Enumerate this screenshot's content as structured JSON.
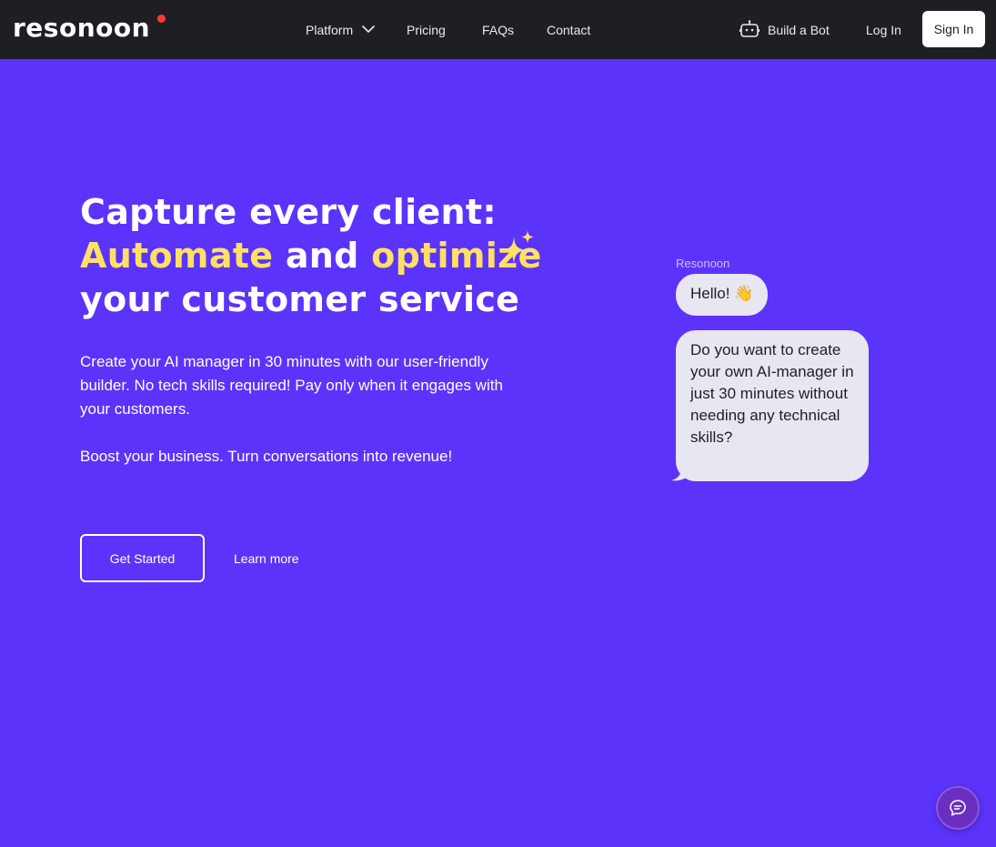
{
  "header": {
    "logo": "resonoon",
    "nav": [
      {
        "label": "Platform"
      },
      {
        "label": "Pricing"
      },
      {
        "label": "FAQs"
      },
      {
        "label": "Contact"
      }
    ],
    "build_bot": "Build a Bot",
    "login": "Log In",
    "signin": "Sign In"
  },
  "hero": {
    "line1": "Capture every client:",
    "accent1": "Automate",
    "and": " and ",
    "accent2": "optimize",
    "line3": "your customer service",
    "para1": "Create your AI manager in 30 minutes with our user-friendly builder. No tech skills required! Pay only when it engages with your customers.",
    "para2": "Boost your business. Turn conversations into revenue!",
    "get_started": "Get Started",
    "learn_more": "Learn more"
  },
  "chat": {
    "sender": "Resonoon",
    "msg1": "Hello! 👋",
    "msg2": "Do you want to create your own AI-manager in just 30 minutes without needing any technical skills?"
  },
  "colors": {
    "background": "#5c33fb",
    "header": "#1f1f23",
    "accent": "#ffe066",
    "bubble": "#e8e6f0"
  },
  "icons": {
    "dropdown": "chevron-down-icon",
    "bot": "robot-icon",
    "sparkle": "sparkle-icon",
    "widget": "chat-bubble-icon"
  }
}
